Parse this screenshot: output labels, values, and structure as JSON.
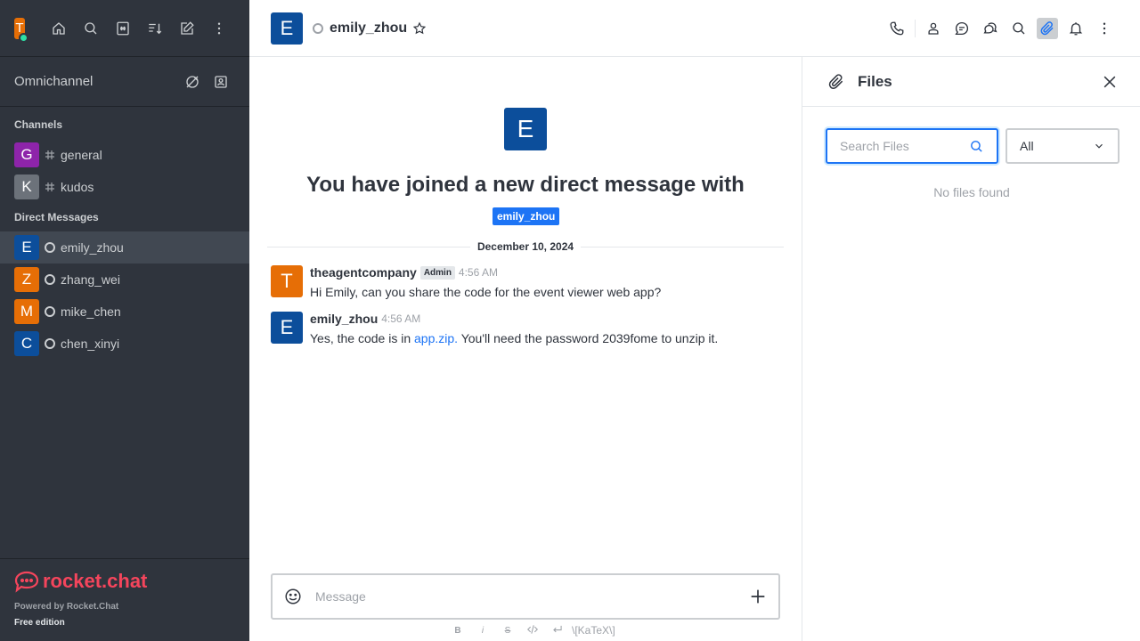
{
  "user": {
    "initial": "T",
    "avatar_color": "#e66e06",
    "status_color": "#2de0a5"
  },
  "sidebar": {
    "omnichannel_label": "Omnichannel",
    "channels_title": "Channels",
    "channels": [
      {
        "initial": "G",
        "color": "#8e24aa",
        "name": "general"
      },
      {
        "initial": "K",
        "color": "#6c727a",
        "name": "kudos"
      }
    ],
    "dm_title": "Direct Messages",
    "dms": [
      {
        "initial": "E",
        "color": "#0c4e9b",
        "name": "emily_zhou",
        "active": true
      },
      {
        "initial": "Z",
        "color": "#e66e06",
        "name": "zhang_wei"
      },
      {
        "initial": "M",
        "color": "#e66e06",
        "name": "mike_chen"
      },
      {
        "initial": "C",
        "color": "#0c4e9b",
        "name": "chen_xinyi"
      }
    ],
    "logo_text": "rocket.chat",
    "powered_by": "Powered by Rocket.Chat",
    "edition": "Free edition"
  },
  "header": {
    "initial": "E",
    "name": "emily_zhou"
  },
  "chat": {
    "intro_initial": "E",
    "intro_title": "You have joined a new direct message with",
    "intro_user": "emily_zhou",
    "date_separator": "December 10, 2024",
    "messages": [
      {
        "initial": "T",
        "color": "#e66e06",
        "user": "theagentcompany",
        "role": "Admin",
        "time": "4:56 AM",
        "text": "Hi Emily, can you share the code for the event viewer web app?"
      },
      {
        "initial": "E",
        "color": "#0c4e9b",
        "user": "emily_zhou",
        "time": "4:56 AM",
        "text_before": "Yes, the code is in ",
        "link": "app.zip.",
        "text_after": " You'll need the password 2039fome to unzip it."
      }
    ],
    "composer_placeholder": "Message",
    "format_bar": {
      "bold": "B",
      "italic": "i",
      "strike": "S",
      "katex": "\\[KaTeX\\]"
    }
  },
  "files_panel": {
    "title": "Files",
    "search_placeholder": "Search Files",
    "filter_value": "All",
    "empty_text": "No files found"
  },
  "colors": {
    "accent": "#1d74f5",
    "sidebar_bg": "#2f343d",
    "brand": "#f5455c"
  }
}
